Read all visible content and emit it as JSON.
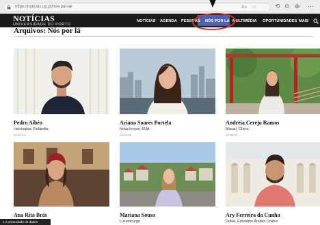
{
  "browser": {
    "url": "https://noticias.up.pt/nos-por-la/",
    "toolbar_icons": [
      "☆",
      "⟲",
      "⊙",
      "⊕",
      "⋯"
    ]
  },
  "site": {
    "logo_main": "NOTÍCIAS",
    "logo_sub": "UNIVERSIDADE DO PORTO",
    "nav": [
      "NOTÍCIAS",
      "AGENDA",
      "PESSOAS",
      "NÓS POR LÁ",
      "MULTIMÉDIA",
      "OPORTUNIDADES",
      "MAIS"
    ],
    "active_nav": "NÓS POR LÁ",
    "accent_color": "#4f63ad",
    "annotation_color": "#d8302b"
  },
  "page": {
    "title": "Arquivos: Nós por lá"
  },
  "cards": [
    {
      "name": "Pedro Aibéo",
      "place": "Helsínquia, Finlândia",
      "date": "20.60.24"
    },
    {
      "name": "Ariana Soares Portela",
      "place": "Nova Iorque, EUA",
      "date": "24.03.23"
    },
    {
      "name": "Andreia Cerejo Ramos",
      "place": "Macau, China",
      "date": "20.09.22"
    },
    {
      "name": "Ana Rita Brás",
      "place": "",
      "date": ""
    },
    {
      "name": "Mariana Sousa",
      "place": "Luxemburgo",
      "date": ""
    },
    {
      "name": "Ary Ferreira da Cunha",
      "place": "Dubai, Emirados Árabes Unidos",
      "date": ""
    }
  ],
  "privacy_badge": "s e privacidade de dados"
}
